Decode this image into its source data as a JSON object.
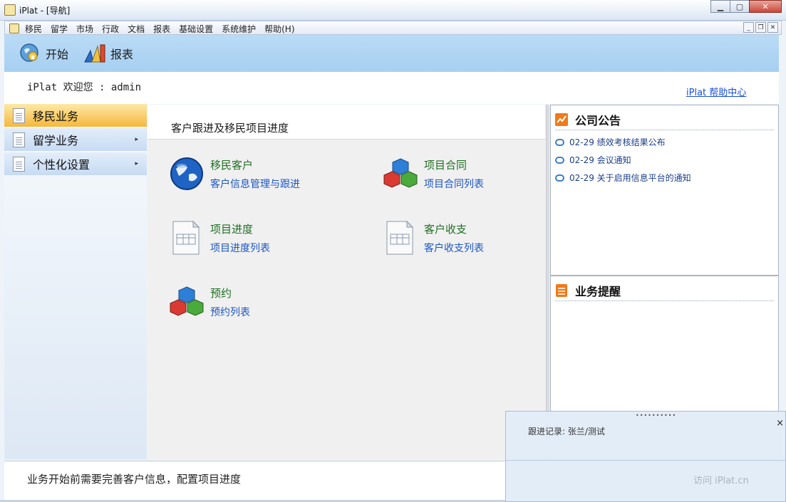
{
  "window": {
    "title": "iPlat - [导航]"
  },
  "menu": {
    "items": [
      "移民",
      "留学",
      "市场",
      "行政",
      "文档",
      "报表",
      "基础设置",
      "系统维护",
      "帮助(H)"
    ]
  },
  "toolbar": {
    "start_label": "开始",
    "report_label": "报表"
  },
  "header": {
    "welcome": "iPlat 欢迎您 : admin",
    "help_link": "iPlat 帮助中心"
  },
  "sidebar": {
    "items": [
      {
        "label": "移民业务",
        "active": true
      },
      {
        "label": "留学业务",
        "arrow": "▸"
      },
      {
        "label": "个性化设置",
        "arrow": "▸"
      }
    ]
  },
  "main": {
    "heading": "客户跟进及移民项目进度",
    "tiles": [
      {
        "title": "移民客户",
        "link": "客户信息管理与跟进",
        "icon": "globe-icon"
      },
      {
        "title": "项目合同",
        "link": "项目合同列表",
        "icon": "cubes-icon"
      },
      {
        "title": "项目进度",
        "link": "项目进度列表",
        "icon": "document-table-icon"
      },
      {
        "title": "客户收支",
        "link": "客户收支列表",
        "icon": "document-table-icon"
      },
      {
        "title": "预约",
        "link": "预约列表",
        "icon": "cubes-icon"
      }
    ]
  },
  "announcements": {
    "title": "公司公告",
    "items": [
      "02-29 绩效考核结果公布",
      "02-29 会议通知",
      "02-29 关于启用信息平台的通知"
    ]
  },
  "reminders": {
    "title": "业务提醒"
  },
  "footer": {
    "hint": "业务开始前需要完善客户信息，配置项目进度"
  },
  "popup": {
    "text": "跟进记录: 张兰/测试",
    "link": "访问 iPlat.cn",
    "close": "×"
  },
  "colors": {
    "toolbar": "#a7cff1",
    "active_item": "#f6b73c",
    "link": "#1b56c7",
    "tile_title": "#1f6f22"
  }
}
